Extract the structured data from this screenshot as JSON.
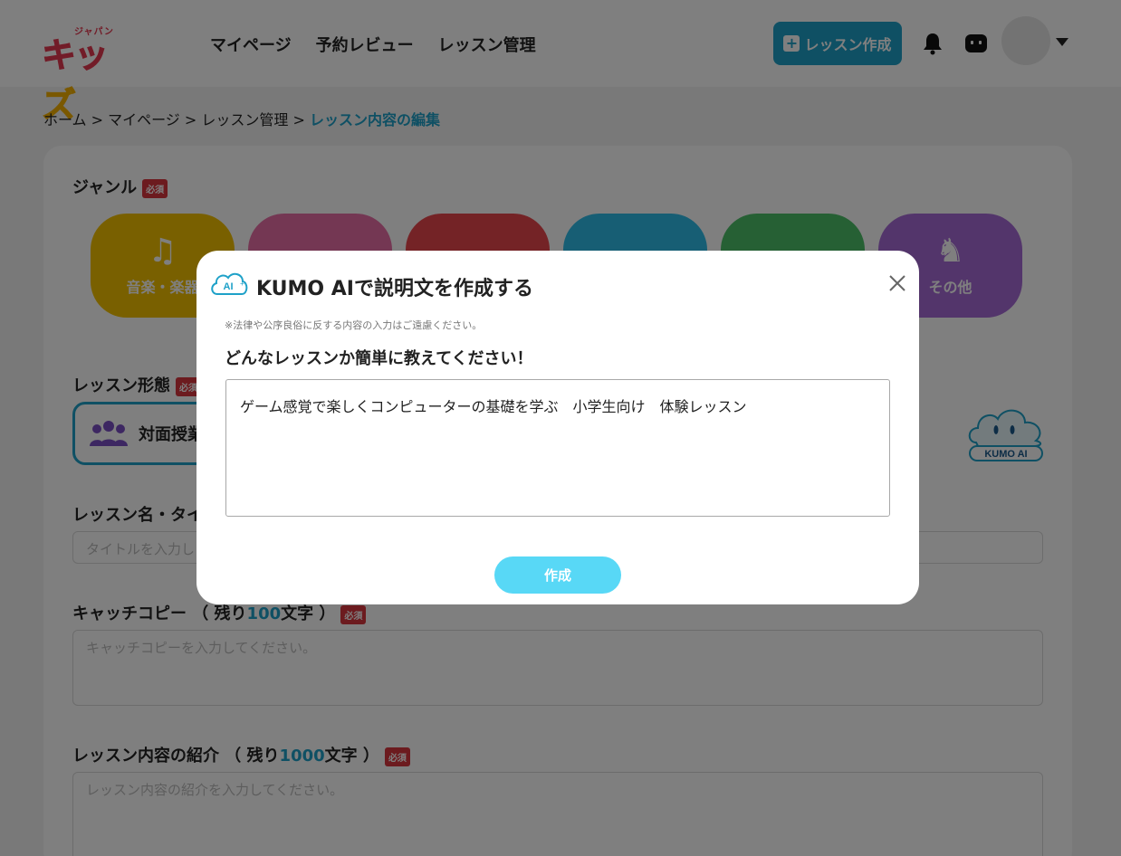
{
  "header": {
    "logo_small": "ジャパン",
    "logo_main_1": "キッ",
    "logo_main_2": "ズ",
    "nav": [
      "マイページ",
      "予約レビュー",
      "レッスン管理"
    ],
    "create_button": "レッスン作成"
  },
  "breadcrumb": {
    "items": [
      "ホーム",
      "マイページ",
      "レッスン管理"
    ],
    "separator": ">",
    "current": "レッスン内容の編集"
  },
  "form": {
    "required_badge": "必須",
    "genre_label": "ジャンル",
    "genres": [
      {
        "label": "音楽・楽器",
        "icon": "music-note-icon",
        "color": "#f3c000"
      },
      {
        "label": "",
        "icon": "palette-icon",
        "color": "#e96fa6"
      },
      {
        "label": "",
        "icon": "book-icon",
        "color": "#e9474d"
      },
      {
        "label": "",
        "icon": "ball-icon",
        "color": "#2fbde8"
      },
      {
        "label": "",
        "icon": "tablet-icon",
        "color": "#4cc069"
      },
      {
        "label": "その他",
        "icon": "chess-knight-icon",
        "color": "#a66bd6"
      }
    ],
    "lesson_form_label": "レッスン形態",
    "lesson_form_option": "対面授業",
    "mascot_label": "KUMO AI",
    "title_label": "レッスン名・タイ",
    "title_placeholder": "タイトルを入力し",
    "catch_label_pre": "キャッチコピー （ 残り",
    "catch_remaining": "100",
    "catch_label_post": "文字 ）",
    "catch_placeholder": "キャッチコピーを入力してください。",
    "intro_label_pre": "レッスン内容の紹介 （ 残り",
    "intro_remaining": "1000",
    "intro_label_post": "文字 ）",
    "intro_placeholder": "レッスン内容の紹介を入力してください。"
  },
  "modal": {
    "badge": "AI",
    "title": "KUMO AIで説明文を作成する",
    "note": "※法律や公序良俗に反する内容の入力はご遠慮ください。",
    "question": "どんなレッスンか簡単に教えてください！",
    "input_value": "ゲーム感覚で楽しくコンピューターの基礎を学ぶ　小学生向け　体験レッスン",
    "submit_label": "作成"
  },
  "colors": {
    "accent": "#1ea1c8",
    "submit": "#58d8f6",
    "required": "#d9363e",
    "brand_red": "#e53950",
    "brand_yellow": "#f4b000"
  }
}
